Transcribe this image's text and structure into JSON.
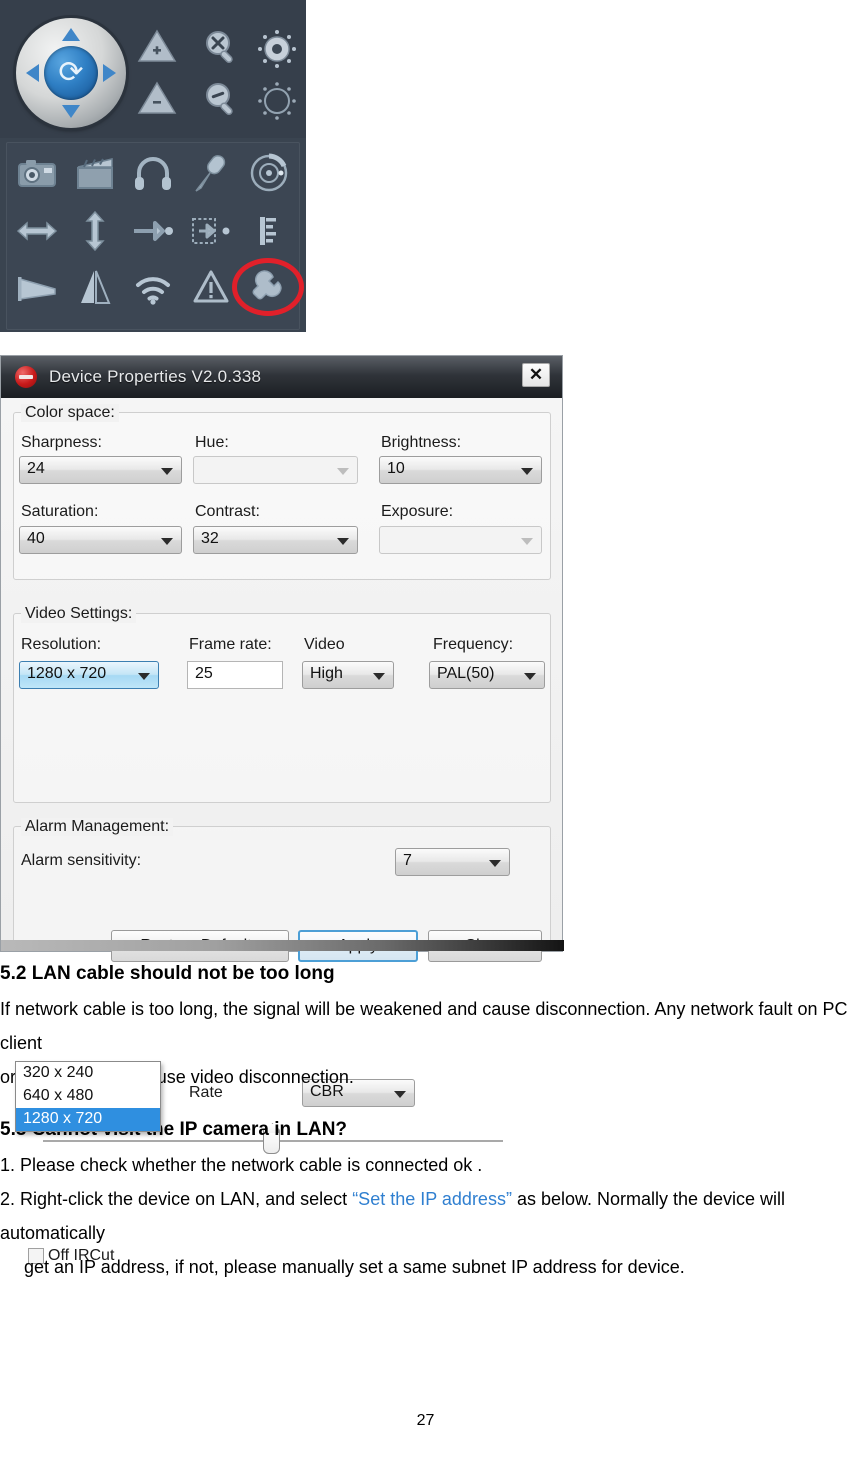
{
  "ptz_panel": {
    "name": "camera-ptz-control-panel",
    "joystick": {
      "center_icon": "refresh-icon",
      "up": "pan-up-arrow",
      "down": "pan-down-arrow",
      "left": "pan-left-arrow",
      "right": "pan-right-arrow"
    },
    "adjust_icons": [
      "focus-near-icon",
      "zoom-in-icon",
      "iris-open-icon",
      "focus-far-icon",
      "zoom-out-icon",
      "iris-close-icon"
    ],
    "tool_icons": [
      "snapshot-camera-icon",
      "record-clapperboard-icon",
      "listen-headphone-icon",
      "talk-microphone-icon",
      "ptz-preset-dial-icon",
      "horizontal-scan-icon",
      "vertical-scan-icon",
      "auto-tour-icon",
      "preset-set-icon",
      "color-bar-icon",
      "perspective-icon",
      "mirror-flip-icon",
      "wifi-icon",
      "alarm-warning-icon",
      "device-settings-wrench-icon"
    ],
    "highlight": {
      "target": "device-settings-wrench-icon",
      "color": "#e1202a"
    }
  },
  "dialog": {
    "title": "Device Properties V2.0.338",
    "close_label": "✕",
    "groups": {
      "color_space": {
        "legend": "Color space:",
        "fields": [
          {
            "label": "Sharpness:",
            "value": "24",
            "enabled": true
          },
          {
            "label": "Hue:",
            "value": "",
            "enabled": false
          },
          {
            "label": "Brightness:",
            "value": "10",
            "enabled": true
          },
          {
            "label": "Saturation:",
            "value": "40",
            "enabled": true
          },
          {
            "label": "Contrast:",
            "value": "32",
            "enabled": true
          },
          {
            "label": "Exposure:",
            "value": "",
            "enabled": false
          }
        ]
      },
      "video_settings": {
        "legend": "Video Settings:",
        "resolution_label": "Resolution:",
        "resolution_value": "1280 x 720",
        "resolution_options": [
          "320 x 240",
          "640 x 480",
          "1280 x 720"
        ],
        "resolution_selected_index": 2,
        "frame_rate_label": "Frame rate:",
        "frame_rate_value": "25",
        "video_label": "Video",
        "video_value": "High",
        "frequency_label": "Frequency:",
        "frequency_value": "PAL(50)",
        "rate_label": "Rate",
        "rate_value": "CBR"
      },
      "alarm_management": {
        "legend": "Alarm Management:",
        "sensitivity_label": "Alarm sensitivity:",
        "sensitivity_value": "7",
        "ircut_label": "Off IRCut",
        "ircut_checked": false
      }
    },
    "buttons": {
      "restore": "Restore Defaults",
      "apply": "Apply",
      "close": "Close"
    }
  },
  "document": {
    "section_52": {
      "heading": "5.2 LAN cable should not be too long",
      "paragraph_line1": "If network cable is too long, the signal will be weakened and cause disconnection. Any network fault on PC client",
      "paragraph_line2": "or IP camera will cause video disconnection."
    },
    "section_53": {
      "heading": "5.3 Cannot visit the IP camera in LAN?",
      "item1": "1. Please check whether the network cable is connected ok .",
      "item2_pre": "2. Right-click the device on LAN, and select ",
      "item2_link": "“Set the IP address”",
      "item2_post": " as below. Normally the device will automatically",
      "item2_cont": "get an IP address, if not, please manually set a same subnet IP address for device."
    },
    "page_number": "27"
  }
}
